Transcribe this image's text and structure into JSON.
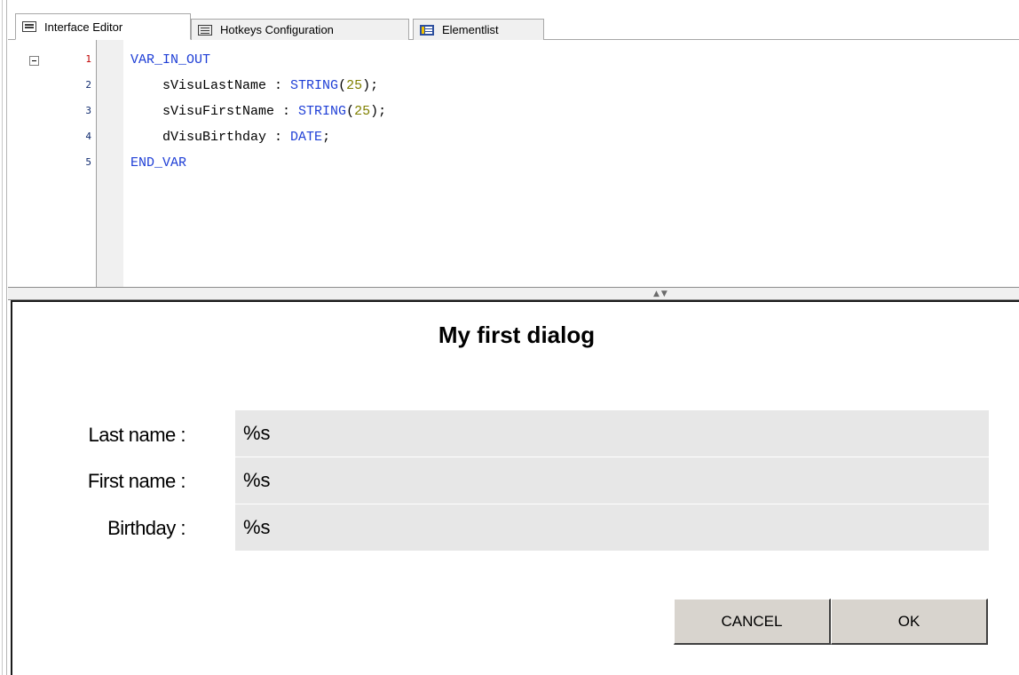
{
  "tabs": [
    {
      "label": "Interface Editor",
      "icon": "editor-icon",
      "active": true
    },
    {
      "label": "Hotkeys Configuration",
      "icon": "keyboard-icon",
      "active": false
    },
    {
      "label": "Elementlist",
      "icon": "element-list-icon",
      "active": false
    }
  ],
  "editor": {
    "lines": [
      {
        "number": "1",
        "tokens": [
          {
            "t": "VAR_IN_OUT",
            "c": "kw"
          }
        ]
      },
      {
        "number": "2",
        "tokens": [
          {
            "t": "    sVisuLastName",
            "c": "ident"
          },
          {
            "t": " : ",
            "c": "ident"
          },
          {
            "t": "STRING",
            "c": "kw"
          },
          {
            "t": "(",
            "c": "ident"
          },
          {
            "t": "25",
            "c": "num"
          },
          {
            "t": ");",
            "c": "ident"
          }
        ]
      },
      {
        "number": "3",
        "tokens": [
          {
            "t": "    sVisuFirstName",
            "c": "ident"
          },
          {
            "t": " : ",
            "c": "ident"
          },
          {
            "t": "STRING",
            "c": "kw"
          },
          {
            "t": "(",
            "c": "ident"
          },
          {
            "t": "25",
            "c": "num"
          },
          {
            "t": ");",
            "c": "ident"
          }
        ]
      },
      {
        "number": "4",
        "tokens": [
          {
            "t": "    dVisuBirthday",
            "c": "ident"
          },
          {
            "t": " : ",
            "c": "ident"
          },
          {
            "t": "DATE",
            "c": "kw"
          },
          {
            "t": ";",
            "c": "ident"
          }
        ]
      },
      {
        "number": "5",
        "tokens": [
          {
            "t": "END_VAR",
            "c": "kw"
          }
        ]
      }
    ]
  },
  "dialog": {
    "title": "My first dialog",
    "fields": [
      {
        "label": "Last name :",
        "value": "%s"
      },
      {
        "label": "First name :",
        "value": "%s"
      },
      {
        "label": "Birthday :",
        "value": "%s"
      }
    ],
    "cancel_label": "CANCEL",
    "ok_label": "OK"
  },
  "colors": {
    "keyword": "#1f3fd6",
    "number": "#808000",
    "field_bg": "#e7e7e7",
    "button_bg": "#d8d4ce"
  }
}
